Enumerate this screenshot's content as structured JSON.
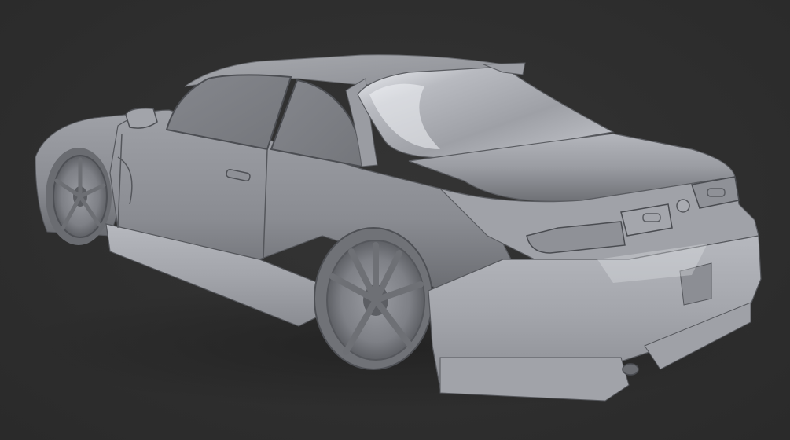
{
  "scene": {
    "subject_icon": "car-render-icon",
    "colors": {
      "background": "#303030",
      "body": "#9c9ea4",
      "body_highlight": "#d8dae0",
      "body_shadow": "#5a5b60",
      "rim": "#8e9096",
      "tire": "#7a7b80"
    }
  }
}
